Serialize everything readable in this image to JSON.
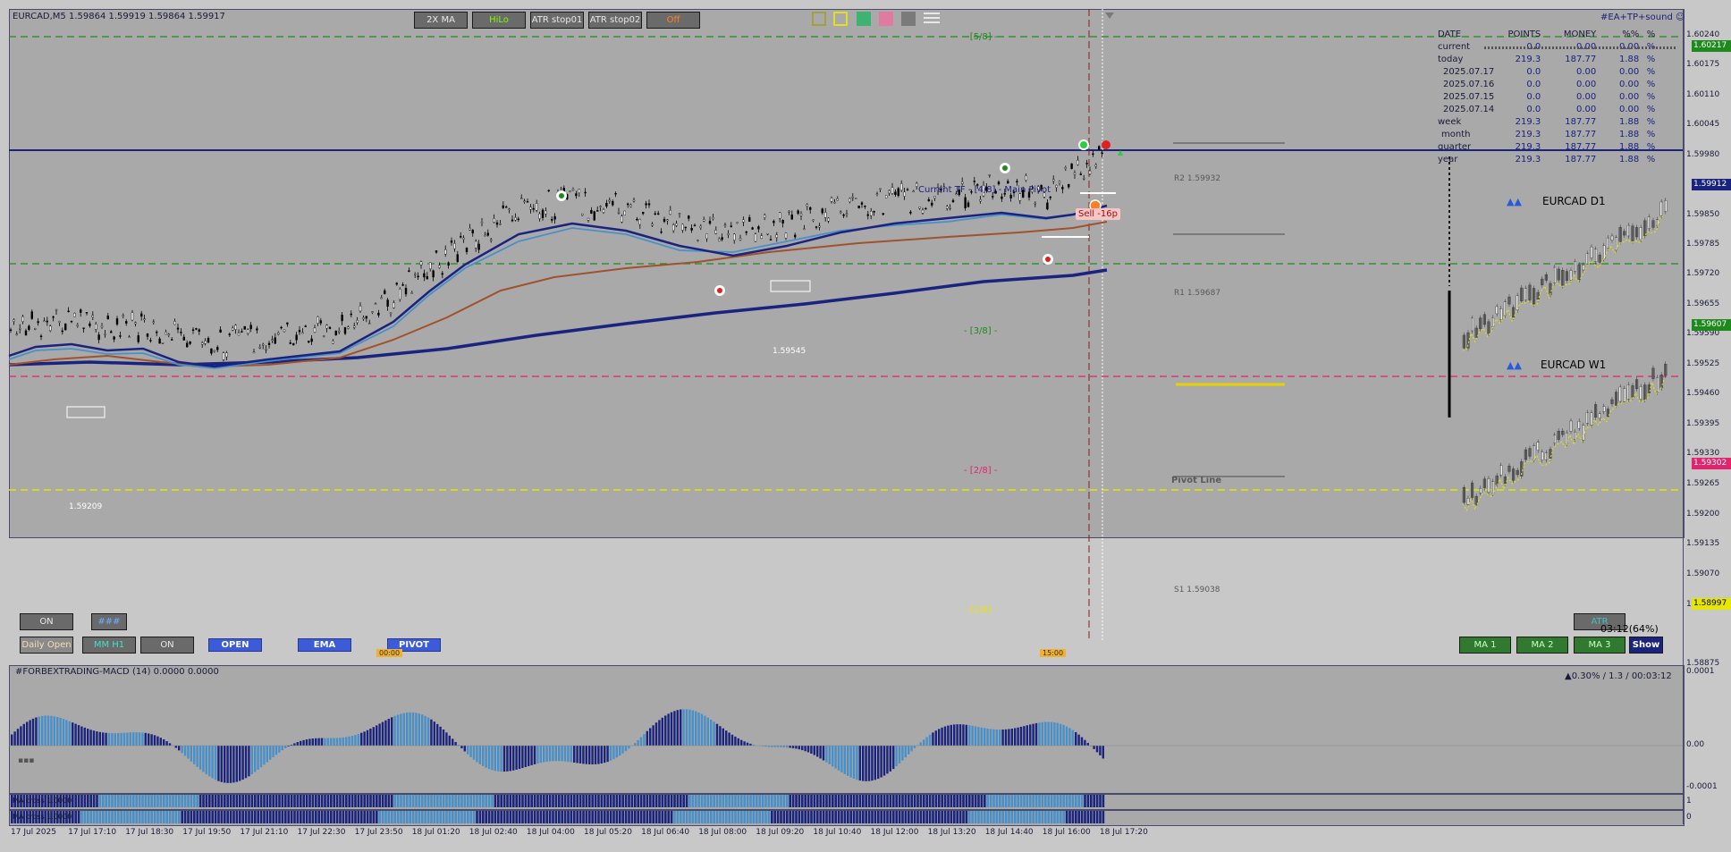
{
  "window": {
    "symbol_info": "EURCAD,M5  1.59864 1.59919 1.59864 1.59917",
    "ea_label": "#EA+TP+sound"
  },
  "top_buttons": [
    {
      "label": "2X MA",
      "color": "#e8e8e8"
    },
    {
      "label": "HiLo",
      "color": "#7CFC00"
    },
    {
      "label": "ATR stop01",
      "color": "#e8e8e8"
    },
    {
      "label": "ATR stop02",
      "color": "#e8e8e8"
    },
    {
      "label": "Off",
      "color": "#ff7f27"
    }
  ],
  "color_swatches": [
    "#a0a040",
    "#e0e020",
    "#3cb371",
    "#e07aa0",
    "#7a7a7a"
  ],
  "levels": {
    "l58": "- [5/8] -",
    "main_pivot": "Current TF - [4/8] - Main Pivot",
    "l38": "- [3/8] -",
    "l28": "- [2/8] -",
    "l18": "- [1/8] -",
    "r2": "R2 1.59932",
    "r1": "R1 1.59687",
    "pivot_line": "Pivot Line",
    "s1": "S1 1.59038",
    "sell_label": "Sell -16p",
    "low_label_1": "1.59209",
    "low_label_2": "1.59545"
  },
  "stats": {
    "headers": [
      "DATE",
      "POINTS",
      "MONEY",
      "%%",
      "%"
    ],
    "rows": [
      [
        "current",
        "0.0",
        "0.00",
        "0.00",
        "%"
      ],
      [
        "today",
        "219.3",
        "187.77",
        "1.88",
        "%"
      ],
      [
        "2025.07.17",
        "0.0",
        "0.00",
        "0.00",
        "%"
      ],
      [
        "2025.07.16",
        "0.0",
        "0.00",
        "0.00",
        "%"
      ],
      [
        "2025.07.15",
        "0.0",
        "0.00",
        "0.00",
        "%"
      ],
      [
        "2025.07.14",
        "0.0",
        "0.00",
        "0.00",
        "%"
      ],
      [
        "week",
        "219.3",
        "187.77",
        "1.88",
        "%"
      ],
      [
        "month",
        "219.3",
        "187.77",
        "1.88",
        "%"
      ],
      [
        "quarter",
        "219.3",
        "187.77",
        "1.88",
        "%"
      ],
      [
        "year",
        "219.3",
        "187.77",
        "1.88",
        "%"
      ]
    ]
  },
  "mini_charts": {
    "d1_title": "EURCAD D1",
    "w1_title": "EURCAD W1",
    "arrows": "▲▲"
  },
  "price_axis": [
    "1.60240",
    "1.60175",
    "1.60110",
    "1.60045",
    "1.59980",
    "1.59850",
    "1.59785",
    "1.59720",
    "1.59655",
    "1.59590",
    "1.59525",
    "1.59460",
    "1.59395",
    "1.59330",
    "1.59265",
    "1.59200",
    "1.59135",
    "1.59070",
    "1.59005",
    "1.58875"
  ],
  "price_labels": {
    "top_green": "1.60217",
    "current": "1.59912",
    "mid_green": "1.59607",
    "pink": "1.59302",
    "yellow": "1.58997"
  },
  "bottom_buttons": {
    "on1": "ON",
    "hash": "###",
    "daily_open": "Daily Open",
    "mm_h1": "MM H1",
    "on2": "ON",
    "open": "OPEN",
    "ema": "EMA",
    "pivot": "PIVOT",
    "atr": "ATR",
    "timer": "03:12(64%)",
    "ma1": "MA 1",
    "ma2": "MA 2",
    "ma3": "MA 3",
    "show": "Show"
  },
  "session_markers": {
    "m1": "00:00",
    "m2": "15:00"
  },
  "macd": {
    "title": "#FORBEXTRADING-MACD (14) 0.0000 0.0000",
    "info": "▲0.30% / 1.3 / 00:03:12",
    "axis_top": "0.0001",
    "axis_mid": "0.00",
    "axis_bot": "-0.0001"
  },
  "cross_panels": {
    "p1": "MA cross 1.0000",
    "p2": "MA cross 1.0000",
    "axis1": "1",
    "axis2": "0"
  },
  "time_axis": [
    "17 Jul 2025",
    "17 Jul 17:10",
    "17 Jul 18:30",
    "17 Jul 19:50",
    "17 Jul 21:10",
    "17 Jul 22:30",
    "17 Jul 23:50",
    "18 Jul 01:20",
    "18 Jul 02:40",
    "18 Jul 04:00",
    "18 Jul 05:20",
    "18 Jul 06:40",
    "18 Jul 08:00",
    "18 Jul 09:20",
    "18 Jul 10:40",
    "18 Jul 12:00",
    "18 Jul 13:20",
    "18 Jul 14:40",
    "18 Jul 16:00",
    "18 Jul 17:20"
  ],
  "colors": {
    "chart_bg": "#a9a9a9",
    "main_pivot": "#1a237e",
    "ma_fast": "#4a90c8",
    "ma_mid": "#a0522d",
    "ma_slow": "#1a237e",
    "level_green": "#1e8a1e",
    "level_pink": "#e0246e",
    "level_yellow": "#e6e600",
    "macd_dark": "#1a237e",
    "macd_light": "#4a90c8"
  }
}
